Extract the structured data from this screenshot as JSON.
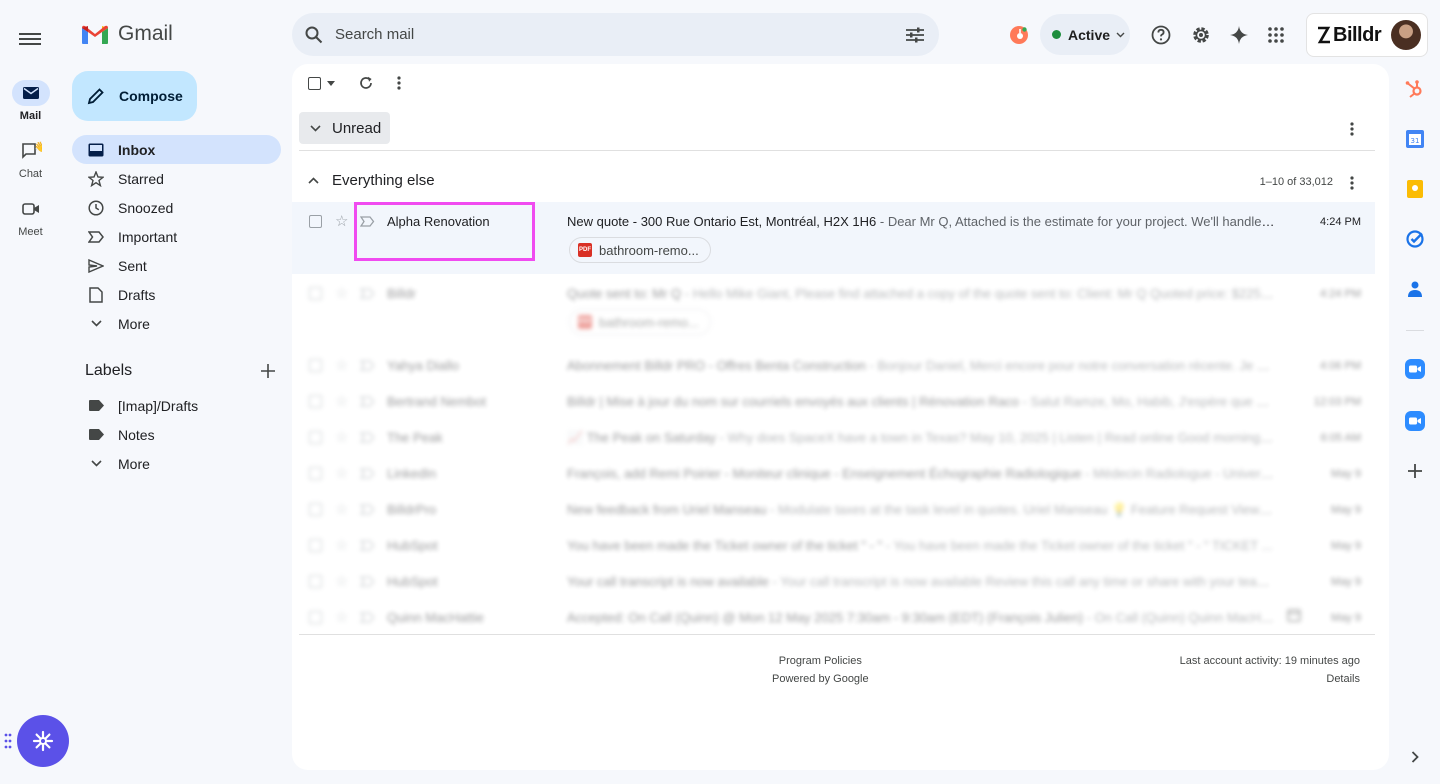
{
  "rail": {
    "mail_label": "Mail",
    "chat_label": "Chat",
    "meet_label": "Meet"
  },
  "header": {
    "app_name": "Gmail",
    "search_placeholder": "Search mail",
    "status_label": "Active",
    "status_color": "#1e8e3e",
    "brand_name": "Billdr"
  },
  "sidebar": {
    "compose_label": "Compose",
    "items": [
      {
        "label": "Inbox",
        "icon": "inbox-icon",
        "active": true
      },
      {
        "label": "Starred",
        "icon": "star-icon"
      },
      {
        "label": "Snoozed",
        "icon": "clock-icon"
      },
      {
        "label": "Important",
        "icon": "important-icon"
      },
      {
        "label": "Sent",
        "icon": "send-icon"
      },
      {
        "label": "Drafts",
        "icon": "draft-icon"
      },
      {
        "label": "More",
        "icon": "chevron-down-icon"
      }
    ],
    "labels_title": "Labels",
    "labels": [
      {
        "label": "[Imap]/Drafts",
        "icon": "label-icon"
      },
      {
        "label": "Notes",
        "icon": "label-icon"
      },
      {
        "label": "More",
        "icon": "chevron-down-icon"
      }
    ]
  },
  "inbox": {
    "section_unread": "Unread",
    "section_else": "Everything else",
    "range": "1–10 of 33,012",
    "emails": [
      {
        "sender": "Alpha Renovation",
        "subject": "New quote - 300 Rue Ontario Est, Montréal, H2X 1H6",
        "snippet": " - Dear Mr Q, Attached is the estimate for your project. We'll handle it ...",
        "time": "4:24 PM",
        "attachment": "bathroom-remo..."
      },
      {
        "sender": "Billdr",
        "subject": "Quote sent to: Mr Q",
        "snippet": " - Hello Mike Giant, Please find attached a copy of the quote sent to: Client: Mr Q Quoted price: $2254...",
        "time": "4:24 PM",
        "attachment": "bathroom-remo..."
      },
      {
        "sender": "Yahya Diallo",
        "subject": "Abonnement Billdr PRO - Offres Benta Construction",
        "snippet": " - Bonjour Daniel, Merci encore pour notre conversation récente. Je vo...",
        "time": "4:06 PM"
      },
      {
        "sender": "Bertrand Nembot",
        "subject": "Billdr | Mise à jour du nom sur courriels envoyés aux clients | Rénovation Raco",
        "snippet": " - Salut Ramze, Mo, Habib, J'espère que vous ...",
        "time": "12:03 PM"
      },
      {
        "sender": "The Peak",
        "subject": "📈 The Peak on Saturday",
        "snippet": " - Why does SpaceX have a town in Texas? May 10, 2025 | Listen | Read online Good morning. Star...",
        "time": "6:05 AM"
      },
      {
        "sender": "LinkedIn",
        "subject": "François, add Remi Poirier - Moniteur clinique - Enseignement Échographie Radiologique",
        "snippet": " - Médecin Radiologue - Universit...",
        "time": "May 9"
      },
      {
        "sender": "BilldrPro",
        "subject": "New feedback from Uriel Manseau",
        "snippet": " - Modulate taxes at the task level in quotes. Uriel Manseau 💡 Feature Request View p...",
        "time": "May 9"
      },
      {
        "sender": "HubSpot",
        "subject": "You have been made the Ticket owner of the ticket \" - \"",
        "snippet": " - You have been made the Ticket owner of the ticket \" - \" TICKET ...",
        "time": "May 9"
      },
      {
        "sender": "HubSpot",
        "subject": "Your call transcript is now available",
        "snippet": " - Your call transcript is now available Review this call any time or share with your team ...",
        "time": "May 9"
      },
      {
        "sender": "Quinn MacHattie",
        "subject": "Accepted: On Call (Quinn) @ Mon 12 May 2025 7:30am - 9:30am (EDT) (François Julien)",
        "snippet": " - On Call (Quinn) Quinn MacHattie ...",
        "time": "May 9"
      }
    ]
  },
  "footer": {
    "policies": "Program Policies",
    "powered": "Powered by Google",
    "activity": "Last account activity: 19 minutes ago",
    "details": "Details"
  },
  "colors": {
    "accent": "#0b57d0",
    "highlight": "#f04bf0",
    "assistant": "#5b51e8"
  }
}
